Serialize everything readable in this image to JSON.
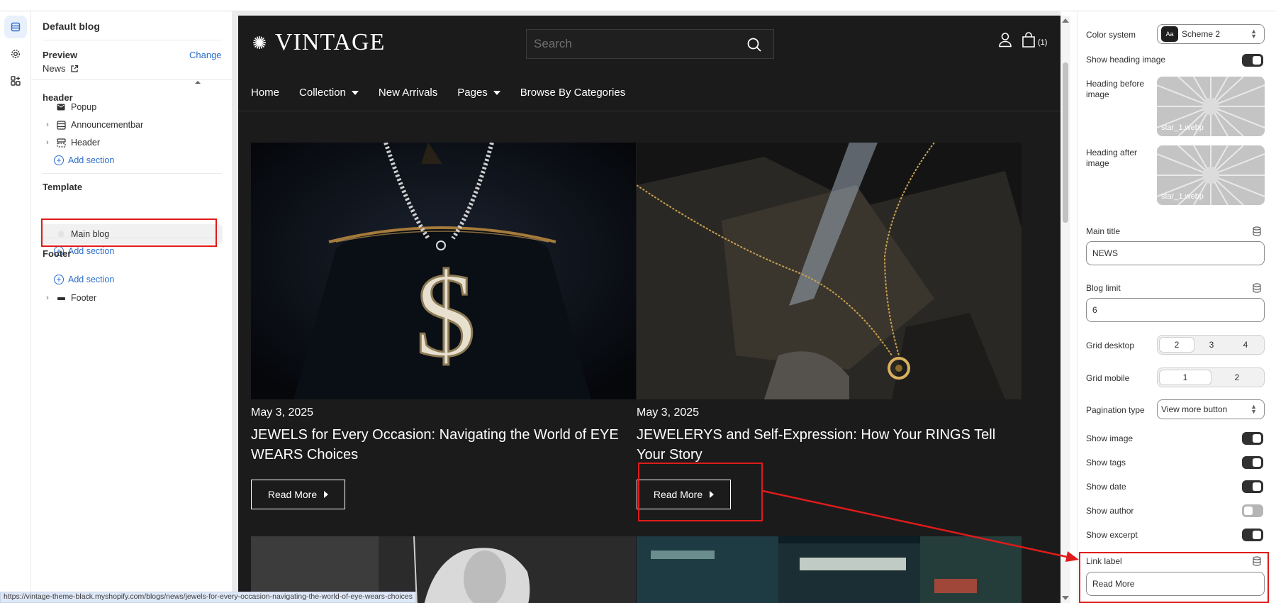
{
  "left_panel": {
    "title": "Default blog",
    "preview": {
      "label": "Preview",
      "change": "Change",
      "page": "News"
    },
    "header_group": {
      "label": "header",
      "items": [
        "Popup",
        "Announcementbar",
        "Header"
      ],
      "add_section": "Add section"
    },
    "template_group": {
      "label": "Template",
      "items": [
        "Main blog"
      ],
      "add_section": "Add section"
    },
    "footer_group": {
      "label": "Footer",
      "add_section": "Add section",
      "items": [
        "Footer"
      ]
    }
  },
  "store": {
    "logo": "VINTAGE",
    "search": {
      "placeholder": "Search"
    },
    "cart_count": "(1)",
    "nav": [
      "Home",
      "Collection",
      "New Arrivals",
      "Pages",
      "Browse By Categories"
    ],
    "posts": [
      {
        "date": "May 3, 2025",
        "title": "JEWELS for Every Occasion: Navigating the World of EYE WEARS Choices",
        "button": "Read More"
      },
      {
        "date": "May 3, 2025",
        "title": "JEWELERYS and Self-Expression: How Your RINGS Tell Your Story",
        "button": "Read More"
      }
    ]
  },
  "right_panel": {
    "color_system": {
      "label": "Color system",
      "badge": "Aa",
      "value": "Scheme 2"
    },
    "show_heading_image": {
      "label": "Show heading image",
      "on": true
    },
    "heading_before_image": {
      "label": "Heading before image",
      "file": "star_1.webp"
    },
    "heading_after_image": {
      "label": "Heading after image",
      "file": "star_1.webp"
    },
    "main_title": {
      "label": "Main title",
      "value": "NEWS"
    },
    "blog_limit": {
      "label": "Blog limit",
      "value": "6"
    },
    "grid_desktop": {
      "label": "Grid desktop",
      "options": [
        "2",
        "3",
        "4"
      ],
      "selected": "2"
    },
    "grid_mobile": {
      "label": "Grid mobile",
      "options": [
        "1",
        "2"
      ],
      "selected": "1"
    },
    "pagination_type": {
      "label": "Pagination type",
      "value": "View more button"
    },
    "show_image": {
      "label": "Show image",
      "on": true
    },
    "show_tags": {
      "label": "Show tags",
      "on": true
    },
    "show_date": {
      "label": "Show date",
      "on": true
    },
    "show_author": {
      "label": "Show author",
      "on": false
    },
    "show_excerpt": {
      "label": "Show excerpt",
      "on": true
    },
    "link_label": {
      "label": "Link label",
      "value": "Read More"
    }
  },
  "status_url": "https://vintage-theme-black.myshopify.com/blogs/news/jewels-for-every-occasion-navigating-the-world-of-eye-wears-choices",
  "colors": {
    "accent": "#2c6ecb",
    "annotation_red": "#e01b1b",
    "store_bg": "#1b1b1b"
  }
}
